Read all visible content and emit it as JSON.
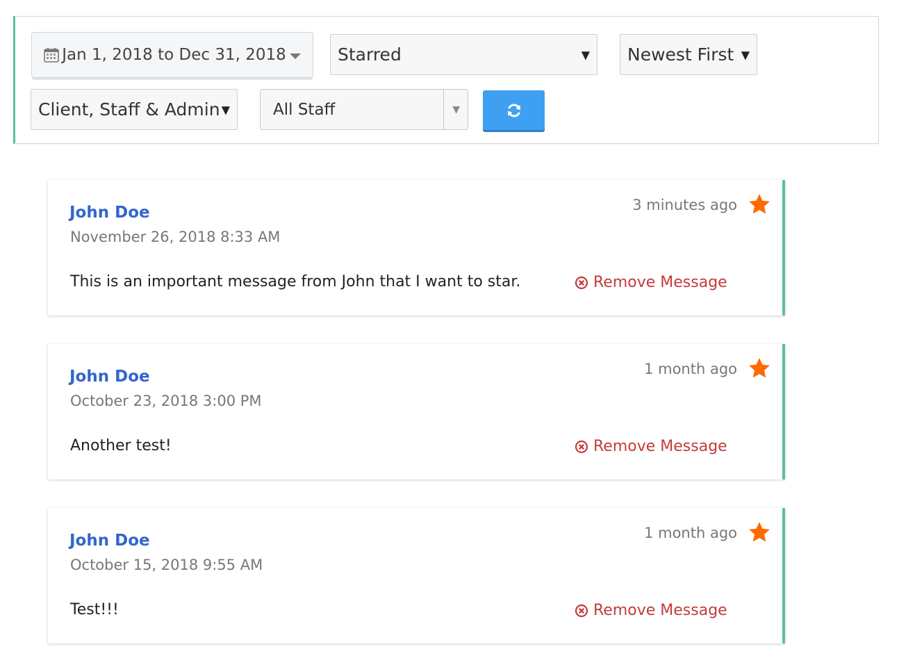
{
  "filters": {
    "date_range": "Jan 1, 2018 to Dec 31, 2018",
    "star_filter": {
      "selected": "Starred"
    },
    "sort_order": {
      "selected": "Newest First"
    },
    "audience": {
      "selected": "Client, Staff & Admin"
    },
    "staff": {
      "selected": "All Staff"
    },
    "refresh_icon": "refresh-icon"
  },
  "colors": {
    "accent_green": "#5cbfa0",
    "author_blue": "#3366cc",
    "star_orange": "#ff6a00",
    "remove_red": "#c33b3b",
    "refresh_blue": "#3fa0f2"
  },
  "messages": [
    {
      "author": "John Doe",
      "date": "November 26, 2018 8:33 AM",
      "relative_time": "3 minutes ago",
      "body": "This is an important message from John that I want to star.",
      "remove_label": "Remove Message",
      "starred_icon": "star-icon"
    },
    {
      "author": "John Doe",
      "date": "October 23, 2018 3:00 PM",
      "relative_time": "1 month ago",
      "body": "Another test!",
      "remove_label": "Remove Message",
      "starred_icon": "star-icon"
    },
    {
      "author": "John Doe",
      "date": "October 15, 2018 9:55 AM",
      "relative_time": "1 month ago",
      "body": "Test!!!",
      "remove_label": "Remove Message",
      "starred_icon": "star-icon"
    }
  ]
}
